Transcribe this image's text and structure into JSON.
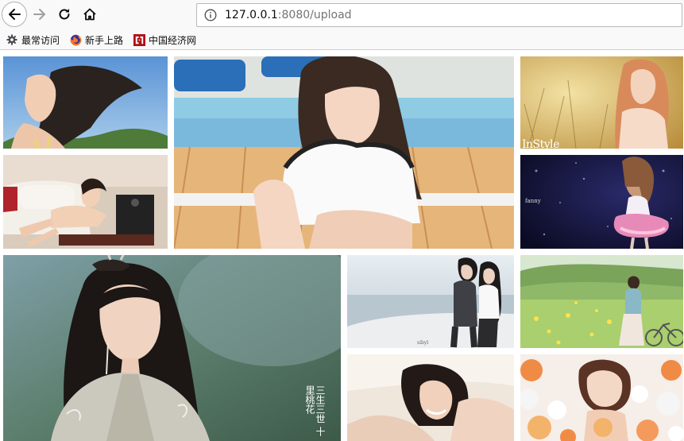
{
  "browser": {
    "url_host": "127.0.0.1",
    "url_rest": ":8080/upload",
    "nav_icons": [
      "back-arrow-icon",
      "forward-arrow-icon",
      "reload-icon",
      "home-icon"
    ],
    "accent": "#0a84ff"
  },
  "bookmarks": [
    {
      "label": "最常访问",
      "icon": "gear-icon"
    },
    {
      "label": "新手上路",
      "icon": "firefox-icon"
    },
    {
      "label": "中国经济网",
      "icon": "cen-logo-icon"
    }
  ],
  "gallery": {
    "photos": [
      {
        "name": "photo-girl-wind-sky"
      },
      {
        "name": "photo-girl-bench-bangs"
      },
      {
        "name": "photo-girl-golden-field"
      },
      {
        "name": "photo-woman-reclining-sofa"
      },
      {
        "name": "photo-girl-stage-pink-dress"
      },
      {
        "name": "photo-actress-drama-poster"
      },
      {
        "name": "photo-couple-seaside"
      },
      {
        "name": "photo-girl-bicycle-meadow"
      },
      {
        "name": "photo-woman-lying-smiling"
      },
      {
        "name": "photo-girl-balloons"
      }
    ],
    "watermark_instyle": "InStyle",
    "poster_vertical_text": "三生三世 十里桃花"
  }
}
